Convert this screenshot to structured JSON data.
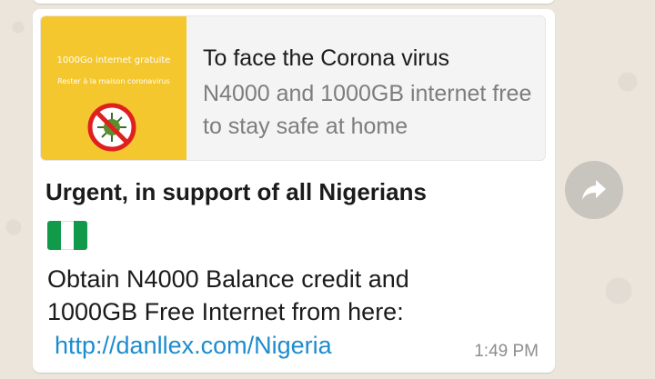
{
  "message": {
    "link_preview": {
      "thumbnail": {
        "line1": "1000Go internet gratuite",
        "line2": "Rester à la maison coronavirus",
        "icon": "no-virus-icon"
      },
      "title": "To face the Corona virus",
      "description": "N4000 and 1000GB internet free to stay safe at home"
    },
    "heading": "Urgent, in support of all Nigerians",
    "flag_emoji": "nigeria-flag",
    "body_lines": [
      " Obtain N4000 Balance credit and",
      "1000GB Free Internet from here:"
    ],
    "link": "http://danllex.com/Nigeria",
    "time": "1:49 PM"
  },
  "forward_button": {
    "icon": "forward-arrow-icon"
  },
  "colors": {
    "thumbnail_bg": "#f5c72e",
    "link": "#1d8ccf",
    "flag_green": "#129a4b",
    "chat_bg": "#ece5dc"
  }
}
